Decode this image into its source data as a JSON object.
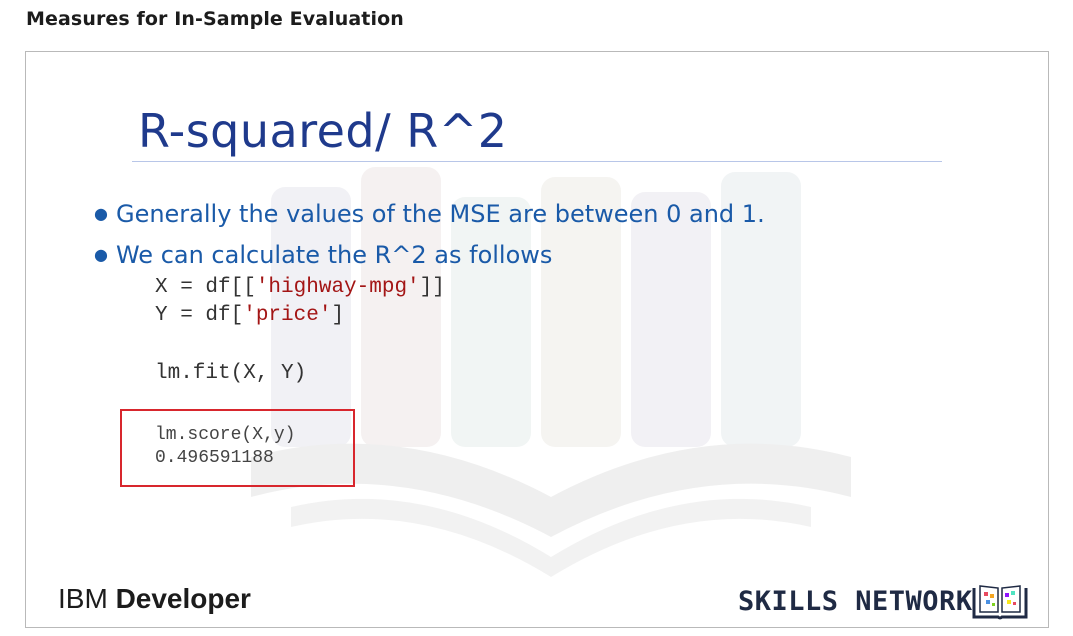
{
  "page": {
    "title": "Measures for In-Sample Evaluation"
  },
  "slide": {
    "heading": "R-squared/ R^2",
    "bullets": [
      "Generally the values of the MSE are between 0 and 1.",
      "We can calculate the R^2 as follows"
    ],
    "code": {
      "line1_prefix": "X = df[[",
      "line1_str": "'highway-mpg'",
      "line1_suffix": "]]",
      "line2_prefix": "Y = df[",
      "line2_str": "'price'",
      "line2_suffix": "]",
      "line3": "lm.fit(X, Y)"
    },
    "score": {
      "call": "lm.score(X,y)",
      "value": "0.496591188"
    },
    "footer": {
      "ibm": "IBM",
      "developer": "Developer",
      "skills_network": "SKILLS NETWORK"
    }
  },
  "colors": {
    "heading": "#1f3a8c",
    "bullet_text": "#1a5aa8",
    "code_string": "#a31515",
    "highlight_box": "#d8262d"
  }
}
